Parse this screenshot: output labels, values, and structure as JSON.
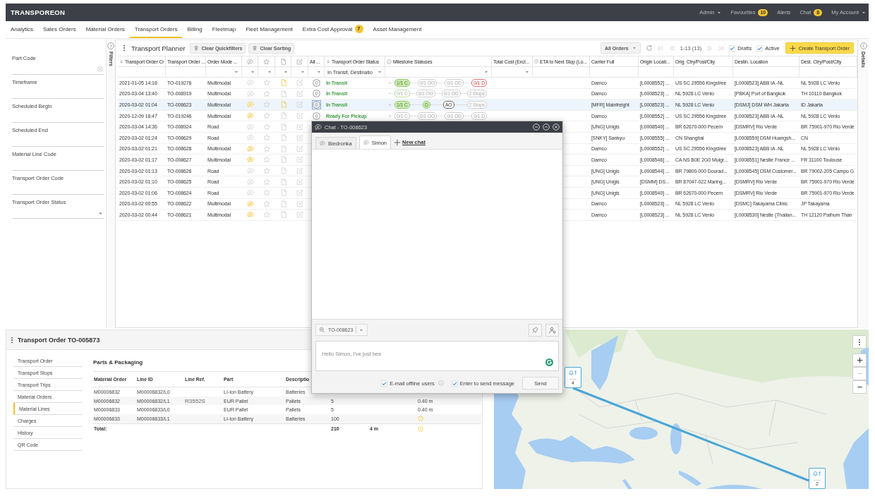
{
  "topbar": {
    "logo": "TRANSPOREON",
    "menu": [
      {
        "label": "Admin",
        "dropdown": true
      },
      {
        "label": "Favourites",
        "badge": "10"
      },
      {
        "label": "Alerts"
      },
      {
        "label": "Chat",
        "badge": "8"
      },
      {
        "label": "My Account",
        "dropdown": true
      }
    ]
  },
  "nav_tabs": [
    {
      "label": "Analytics",
      "selected": false
    },
    {
      "label": "Sales Orders",
      "selected": false
    },
    {
      "label": "Material Orders",
      "selected": false
    },
    {
      "label": "Transport Orders",
      "selected": true
    },
    {
      "label": "Billing",
      "selected": false
    },
    {
      "label": "Fleetmap",
      "selected": false
    },
    {
      "label": "Fleet Management",
      "selected": false
    },
    {
      "label": "Extra Cost Approval",
      "selected": false,
      "badge": "7"
    },
    {
      "label": "Asset Management",
      "selected": false
    }
  ],
  "filters": {
    "tab_label": "Filters",
    "items": [
      {
        "label": "Part Code",
        "kind": "clearable"
      },
      {
        "label": "Timeframe",
        "kind": "text"
      },
      {
        "label": "Scheduled Begin",
        "kind": "text"
      },
      {
        "label": "Scheduled End",
        "kind": "text"
      },
      {
        "label": "Material Line Code",
        "kind": "text"
      },
      {
        "label": "Transport Order Code",
        "kind": "text"
      },
      {
        "label": "Transport Order Status",
        "kind": "dropdown"
      }
    ]
  },
  "planner": {
    "title": "Transport Planner",
    "buttons": [
      "Clear Quickfilters",
      "Clear Sorting"
    ],
    "view": "All Orders",
    "page_info": "1-13 (13)",
    "checkboxes": [
      {
        "label": "Drafts",
        "checked": true
      },
      {
        "label": "Active",
        "checked": true
      }
    ],
    "create_button": "Create Transport Order",
    "columns": [
      {
        "kind": "text",
        "label": "Transport Order Cr",
        "sorted": true,
        "filter": {
          "kind": "input"
        }
      },
      {
        "kind": "text",
        "label": "Transport Order ...",
        "sorted": false,
        "filter": {
          "kind": "input"
        }
      },
      {
        "kind": "text",
        "label": "Order Mode ...",
        "sorted": false,
        "filter": {
          "kind": "dropdown"
        }
      },
      {
        "kind": "chat",
        "filter": {
          "kind": "dropdown"
        }
      },
      {
        "kind": "star",
        "filter": {
          "kind": "dropdown"
        }
      },
      {
        "kind": "document",
        "filter": {
          "kind": "dropdown"
        }
      },
      {
        "kind": "edit",
        "filter": {
          "kind": "dropdown"
        }
      },
      {
        "kind": "text",
        "label": "All ...",
        "sorted": false,
        "filter": {
          "kind": "dropdown"
        }
      },
      {
        "kind": "text",
        "label": "Transport Order Status",
        "sorted": true,
        "filter": {
          "kind": "dropdown",
          "value": "In Transit, Destinatio"
        }
      },
      {
        "kind": "info",
        "label": "Milestone Statuses",
        "sorted": false,
        "filter": {
          "kind": "dropdown"
        }
      },
      {
        "kind": "text",
        "label": "Total Cost (Excl...",
        "sorted": false,
        "filter": {
          "kind": "dropdown"
        }
      },
      {
        "kind": "clock",
        "label": "ETA to Next Stop (Lo...",
        "sorted": false,
        "filter": {
          "kind": "input"
        }
      },
      {
        "kind": "text",
        "label": "Carrier Full",
        "sorted": false,
        "filter": {
          "kind": "input"
        }
      },
      {
        "kind": "text",
        "label": "Origin Locati...",
        "sorted": false,
        "filter": {
          "kind": "input"
        }
      },
      {
        "kind": "text",
        "label": "Orig. Ctry/Post/City",
        "sorted": false,
        "filter": {
          "kind": "input"
        }
      },
      {
        "kind": "text",
        "label": "Destin. Location",
        "sorted": false,
        "filter": {
          "kind": "input"
        }
      },
      {
        "kind": "text",
        "label": "Dest. Ctry/Post/City",
        "sorted": false,
        "filter": {
          "kind": "input"
        }
      }
    ],
    "rows": [
      {
        "created": "2021-01-05 14:16",
        "code": "TO-019276",
        "mode": "Multimodal",
        "has_chat": false,
        "favourite": false,
        "has_document": true,
        "selected": false,
        "status": "In Transit",
        "milestones": [
          {
            "label": "1/1 C",
            "kind": "done"
          },
          {
            "label": "0/1 OO",
            "kind": "open"
          },
          {
            "label": "0/1 OD",
            "kind": "open"
          },
          {
            "label": "0/1 D",
            "kind": "overdue"
          }
        ],
        "carrier": "Damco",
        "origin_location": "[L0008552] ...",
        "origin_city": "US SC 29556 Kingstree",
        "destination_location": "[L0008523] ABB IA -NL",
        "destination_city": "NL 5928 LC Venlo"
      },
      {
        "created": "2020-03-04 13:40",
        "code": "TO-008919",
        "mode": "Multimodal",
        "has_chat": false,
        "favourite": false,
        "has_document": false,
        "selected": false,
        "status": "In Transit",
        "milestones": [
          {
            "label": "0/1 C",
            "kind": "started"
          },
          {
            "label": "0/1 OO",
            "kind": "open"
          },
          {
            "label": "0/1 OD",
            "kind": "open"
          },
          {
            "label": "2 Stops",
            "kind": "open"
          }
        ],
        "carrier": "Damco",
        "origin_location": "[L0008523] ...",
        "origin_city": "NL 5928 LC Venlo",
        "destination_location": "[PBKA] Port of Bangkok",
        "destination_city": "TH 10110 Bangkok"
      },
      {
        "created": "2020-03-02 01:04",
        "code": "TO-008623",
        "mode": "Multimodal",
        "has_chat": true,
        "favourite": false,
        "has_document": true,
        "selected": true,
        "status": "In Transit",
        "milestones": [
          {
            "label": "1/1 C",
            "kind": "done"
          },
          {
            "label": "D",
            "kind": "done"
          },
          {
            "label": "AO",
            "kind": "current"
          },
          {
            "label": "2 Stops",
            "kind": "open"
          }
        ],
        "carrier": "[MFR] Mainfreight",
        "origin_location": "[L0008523] ...",
        "origin_city": "NL 5928 LC Venlo",
        "destination_location": "[DSMJ] DSM WH Jakarta",
        "destination_city": "ID Jakarta"
      },
      {
        "created": "2020-12-09 16:47",
        "code": "TO-019246",
        "mode": "Multimodal",
        "has_chat": true,
        "favourite": false,
        "has_document": false,
        "selected": false,
        "status": "Ready For Pickup",
        "milestones": [
          {
            "label": "0/1 C",
            "kind": "open"
          },
          {
            "label": "0/1 OO",
            "kind": "open"
          },
          {
            "label": "0/1 OD",
            "kind": "open"
          },
          {
            "label": "0/1 D",
            "kind": "open"
          }
        ],
        "carrier": "Damco",
        "origin_location": "[L0008552] ...",
        "origin_city": "US SC 29556 Kingstree",
        "destination_location": "[L0008523] ABB IA -NL",
        "destination_city": "NL 5928 LC Venlo"
      },
      {
        "created": "2020-03-04 14:36",
        "code": "TO-008924",
        "mode": "Road",
        "has_chat": false,
        "favourite": false,
        "has_document": false,
        "selected": false,
        "carrier": "[UNG] Unigis",
        "origin_location": "[L0008540] ...",
        "origin_city": "BR 62670-000 Pecem",
        "destination_location": "[DSMRV] Rio Verde",
        "destination_city": "BR 75901-970 Rio Verde"
      },
      {
        "created": "2020-03-02 01:24",
        "code": "TO-008629",
        "mode": "Road",
        "has_chat": false,
        "favourite": false,
        "has_document": false,
        "selected": false,
        "carrier": "[SNKY] Sankyu",
        "origin_location": "[L0008555] ...",
        "origin_city": "CN Shanghai",
        "destination_location": "[L0008559] DSM Huangsh...",
        "destination_city": "CN"
      },
      {
        "created": "2020-03-02 01:21",
        "code": "TO-008628",
        "mode": "Multimodal",
        "has_chat": true,
        "favourite": false,
        "has_document": false,
        "selected": false,
        "carrier": "Damco",
        "origin_location": "[L0008552] ...",
        "origin_city": "US SC 29556 Kingstree",
        "destination_location": "[L0008523] ABB IA -NL",
        "destination_city": "NL 5928 LC Venlo"
      },
      {
        "created": "2020-03-02 01:17",
        "code": "TO-008627",
        "mode": "Multimodal",
        "has_chat": true,
        "favourite": false,
        "has_document": false,
        "selected": false,
        "carrier": "Damco",
        "origin_location": "[L0008546] ...",
        "origin_city": "CA NS B0E 2G0 Mulgr...",
        "destination_location": "[L0008551] Nestle France ...",
        "destination_city": "FR 31100 Toulouse"
      },
      {
        "created": "2020-03-02 01:13",
        "code": "TO-008626",
        "mode": "Road",
        "has_chat": false,
        "favourite": false,
        "has_document": false,
        "selected": false,
        "carrier": "[UNG] Unigis",
        "origin_location": "[L0008544] ...",
        "origin_city": "BR 79800-000 Dourad...",
        "destination_location": "[L0008545] DSM Customer...",
        "destination_city": "BR 79002-205 Campo G"
      },
      {
        "created": "2020-03-02 01:10",
        "code": "TO-008625",
        "mode": "Road",
        "has_chat": false,
        "favourite": false,
        "has_document": false,
        "selected": false,
        "carrier": "[UNG] Unigis",
        "origin_location": "[DSMM] DS...",
        "origin_city": "BR 87047-022 Maring...",
        "destination_location": "[DSMRV] Rio Verde",
        "destination_city": "BR 75901-970 Rio Verde"
      },
      {
        "created": "2020-03-02 01:06",
        "code": "TO-008624",
        "mode": "Road",
        "has_chat": false,
        "favourite": false,
        "has_document": false,
        "selected": false,
        "carrier": "[UNG] Unigis",
        "origin_location": "[L0008540] ...",
        "origin_city": "BR 62670-000 Pecem",
        "destination_location": "[DSMRV] Rio Verde",
        "destination_city": "BR 75901-970 Rio Verde"
      },
      {
        "created": "2020-03-02 00:55",
        "code": "TO-008622",
        "mode": "Multimodal",
        "has_chat": true,
        "favourite": false,
        "has_document": false,
        "selected": false,
        "carrier": "Damco",
        "origin_location": "[L0008523] ...",
        "origin_city": "NL 5928 LC Venlo",
        "destination_location": "[DSMC] Takayama Clinic",
        "destination_city": "JP Takayama"
      },
      {
        "created": "2020-03-02 00:44",
        "code": "TO-008621",
        "mode": "Multimodal",
        "has_chat": true,
        "favourite": false,
        "has_document": false,
        "selected": false,
        "carrier": "Damco",
        "origin_location": "[L0008523] ...",
        "origin_city": "NL 5928 LC Venlo",
        "destination_location": "[L0008530] Nestle (Thailan...",
        "destination_city": "TH 12120 Pathum Than"
      }
    ]
  },
  "details_tab": {
    "label": "Details"
  },
  "order_panel": {
    "title": "Transport Order TO-005873",
    "sections": [
      {
        "label": "Transport Order",
        "selected": false
      },
      {
        "label": "Transport Stops",
        "selected": false
      },
      {
        "label": "Transport Trips",
        "selected": false
      },
      {
        "label": "Material Orders",
        "selected": false
      },
      {
        "label": "Material Lines",
        "selected": true
      },
      {
        "label": "Charges",
        "selected": false
      },
      {
        "label": "History",
        "selected": false
      },
      {
        "label": "QR Code",
        "selected": false
      }
    ],
    "section_title": "Parts & Packaging",
    "columns": [
      "Material Order",
      "Line ID",
      "Line Ref.",
      "Part",
      "Descriptio"
    ],
    "rows": [
      {
        "material_order": "M00006832",
        "line_id": "M00006832/L0",
        "part": "LI-Ion Battery",
        "description": "Batteries",
        "warning": false
      },
      {
        "material_order": "M00006832",
        "line_id": "M00006832/L1",
        "line_ref": "R3552S",
        "part": "EUR Pallet",
        "description": "Pallets",
        "column_6": "5",
        "column_8": "0.40 m",
        "warning": false
      },
      {
        "material_order": "M00006833",
        "line_id": "M00006833/L0",
        "part": "EUR Pallet",
        "description": "Pallets",
        "column_6": "5",
        "column_8": "0.40 m",
        "warning": false
      },
      {
        "material_order": "M00006833",
        "line_id": "M00006833/L1",
        "part": "LI-Ion Battery",
        "description": "Batteries",
        "column_6": "100",
        "warning": true
      }
    ],
    "total": {
      "label": "Total:",
      "column_6": "210",
      "column_7": "4 m",
      "warning": true
    }
  },
  "map": {
    "markers": [
      {
        "count": "4"
      },
      {
        "count": "2"
      }
    ],
    "zoom_buttons": [
      {
        "kind": "plus",
        "disabled": false
      },
      {
        "kind": "minus",
        "disabled": true
      },
      {
        "kind": "minus",
        "disabled": false
      }
    ]
  },
  "chat": {
    "title": "Chat - TO-008623",
    "tabs": [
      {
        "label": "Biedronka",
        "selected": false
      },
      {
        "label": "Simon",
        "selected": true
      }
    ],
    "new_chat": "New chat",
    "order_select": "TO-008623",
    "message": "Hello Simon, I've just bee",
    "options": [
      {
        "label": "E-mail offline users",
        "checked": true,
        "info": true
      },
      {
        "label": "Enter to send message",
        "checked": true,
        "info": false
      }
    ],
    "send_button": "Send"
  }
}
